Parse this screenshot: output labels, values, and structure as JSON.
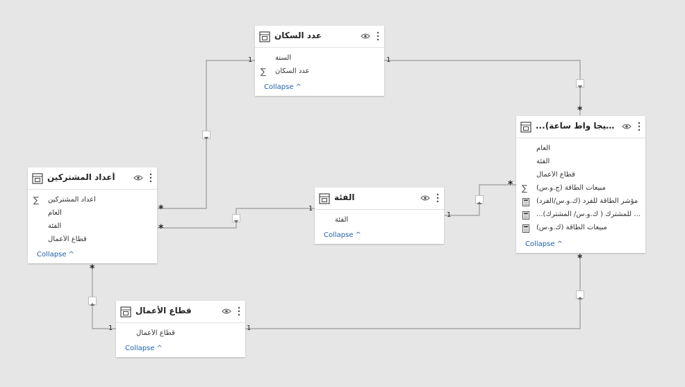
{
  "tables": {
    "population": {
      "title": "عدد السكان",
      "fields": [
        "السنة",
        "عدد السكان"
      ],
      "collapse": "Collapse"
    },
    "subscribers": {
      "title": "أعداد المشتركين",
      "fields": [
        "أعداد المشتركين",
        "العام",
        "الفئة",
        "قطاع الأعمال"
      ],
      "collapse": "Collapse"
    },
    "category": {
      "title": "الفئة",
      "fields": [
        "الفئة"
      ],
      "collapse": "Collapse"
    },
    "sector": {
      "title": "قطاع الأعمال",
      "fields": [
        "قطاع الأعمال"
      ],
      "collapse": "Collapse"
    },
    "energy": {
      "title": "...لمبيعة (جيجا واط ساعة)",
      "fields": [
        "العام",
        "الفئة",
        "قطاع الأعمال",
        "مبيعات الطاقة (ج.و.س)",
        "مؤشر الطاقة للفرد (ك.و.س/الفرد)",
        "...اقة للمشترك ( ك.و.س/ المشترك)",
        "مبيعات الطاقة (ك.و.س)"
      ],
      "collapse": "Collapse"
    }
  },
  "relationships": {
    "one": "1",
    "many": "*"
  },
  "colors": {
    "canvas": "#e6e6e6",
    "line": "#9a9a9a",
    "link": "#1f5fa8"
  }
}
